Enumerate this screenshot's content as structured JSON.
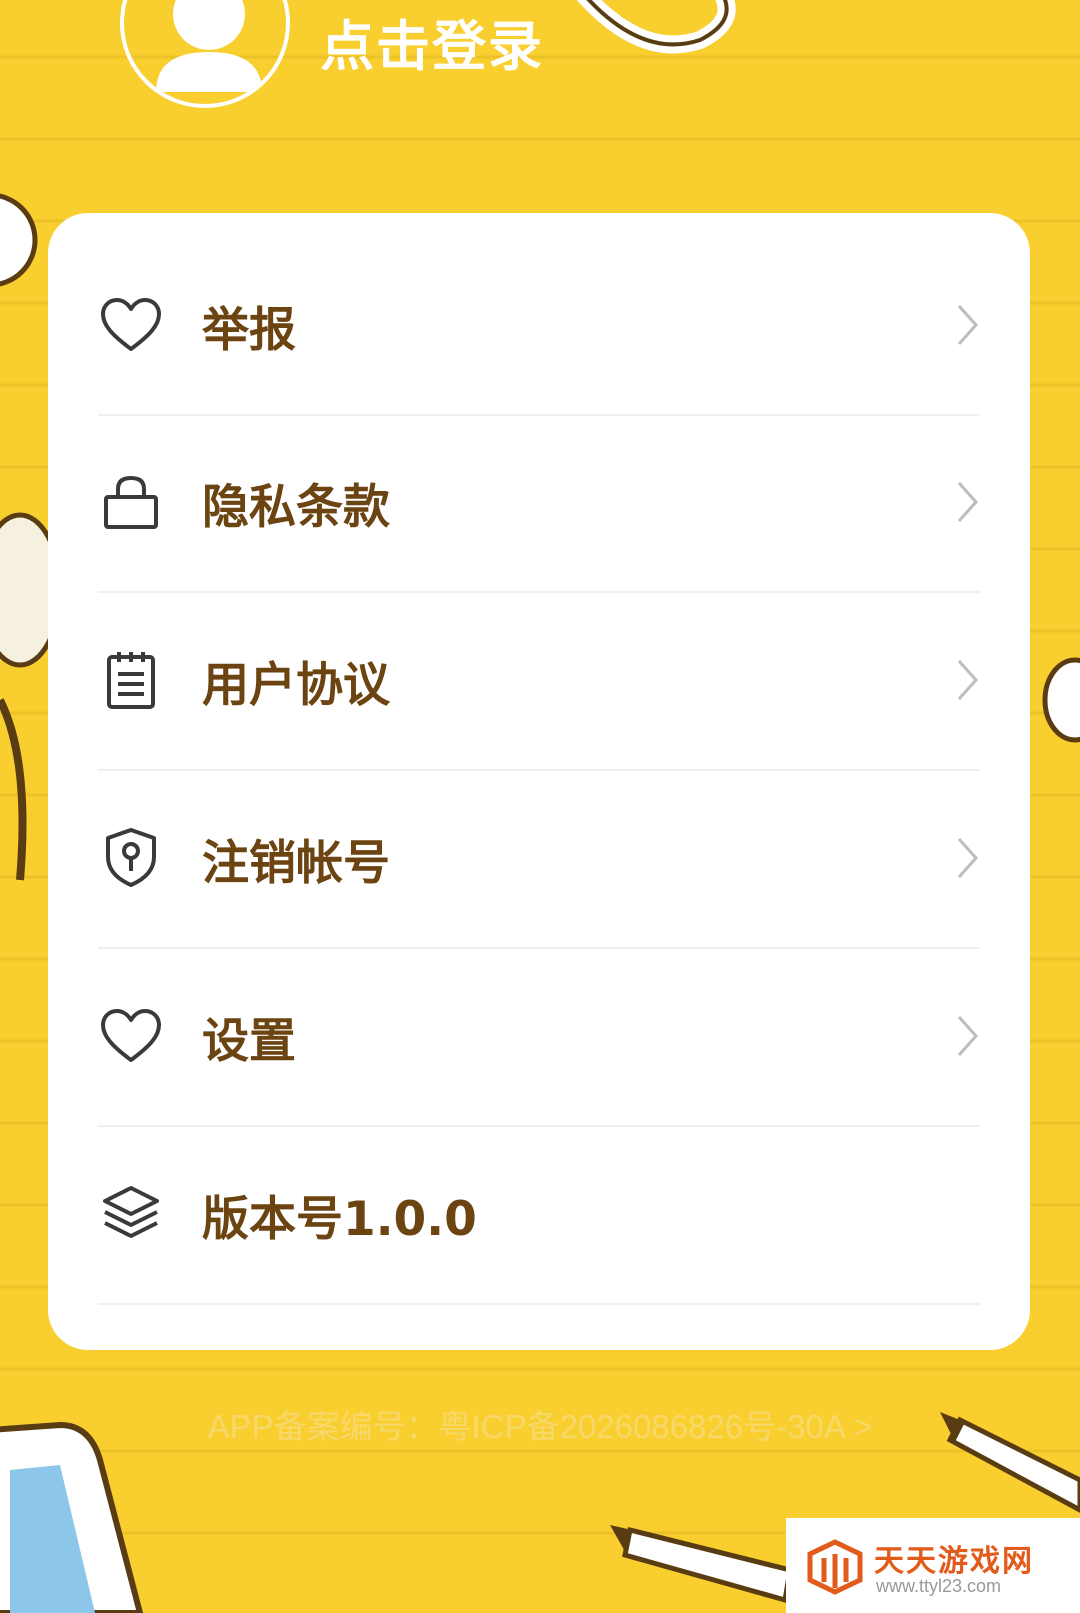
{
  "header": {
    "login_label": "点击登录"
  },
  "menu": {
    "items": [
      {
        "label": "举报",
        "icon": "heart-icon"
      },
      {
        "label": "隐私条款",
        "icon": "lock-icon"
      },
      {
        "label": "用户协议",
        "icon": "notepad-icon"
      },
      {
        "label": "注销帐号",
        "icon": "shield-key-icon"
      },
      {
        "label": "设置",
        "icon": "heart-icon"
      },
      {
        "label": "版本号1.0.0",
        "icon": "layers-icon"
      }
    ]
  },
  "footer": {
    "icp_text": "APP备案编号：粤ICP备2026086826号-30A >"
  },
  "watermark": {
    "title": "天天游戏网",
    "url": "www.ttyl23.com"
  },
  "colors": {
    "background": "#f9ce2f",
    "label": "#6b4412",
    "card": "#ffffff",
    "chevron": "#bdbdbd"
  }
}
